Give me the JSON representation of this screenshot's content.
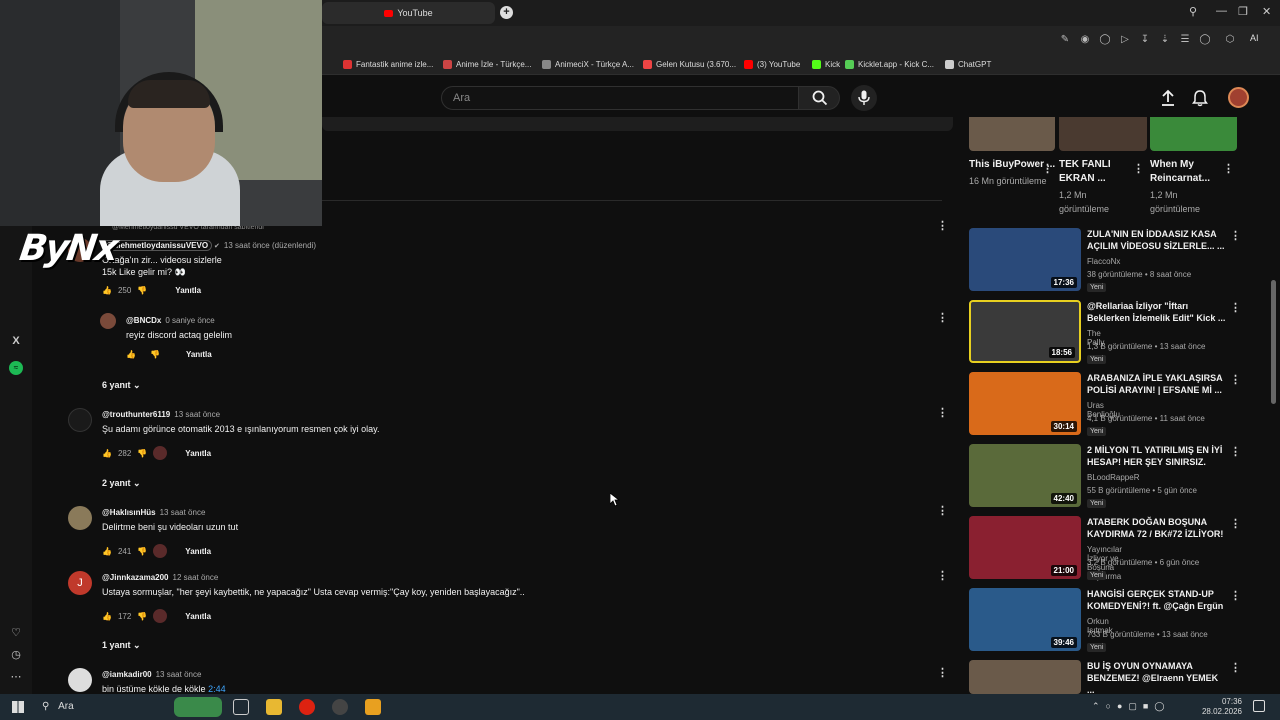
{
  "browser": {
    "tab_title": "YouTube",
    "bookmarks": [
      {
        "label": "Fantastik anime izle...",
        "color": "#d33"
      },
      {
        "label": "Anime İzle - Türkçe...",
        "color": "#c44"
      },
      {
        "label": "AnimeciX - Türkçe A...",
        "color": "#888"
      },
      {
        "label": "Gelen Kutusu (3.670...",
        "color": "#e44"
      },
      {
        "label": "(3) YouTube",
        "color": "#f00"
      },
      {
        "label": "Kick",
        "color": "#53fc18"
      },
      {
        "label": "Kicklet.app - Kick C...",
        "color": "#5c5"
      },
      {
        "label": "ChatGPT",
        "color": "#ccc"
      }
    ],
    "ai_label": "AI"
  },
  "header": {
    "search_placeholder": "Ara"
  },
  "overlay": {
    "brand": "ByNx"
  },
  "comments": {
    "pinned_note": "@Mehmetloydanissu VEVO tarafından sabitlendi",
    "items": [
      {
        "author": "@MehmetloydanissuVEVO",
        "time": "13 saat önce (düzenlendi)",
        "text": "Ortağa'ın zir... videosu sizlerle",
        "text2": "15k Like gelir mi? 👀",
        "likes": "250",
        "reply": "Yanıtla"
      },
      {
        "author": "@BNCDx",
        "time": "0 saniye önce",
        "text": "reyiz discord actaq gelelim",
        "likes": "",
        "reply": "Yanıtla"
      },
      {
        "toggle": "6 yanıt"
      },
      {
        "author": "@trouthunter6119",
        "time": "13 saat önce",
        "text": "Şu adamı görünce otomatik 2013 e ışınlanıyorum resmen çok iyi olay.",
        "likes": "282",
        "reply": "Yanıtla"
      },
      {
        "toggle": "2 yanıt"
      },
      {
        "author": "@HaklısınHüs",
        "time": "13 saat önce",
        "text": "Delirtme beni şu videoları uzun tut",
        "likes": "241",
        "reply": "Yanıtla"
      },
      {
        "author": "@Jinnkazama200",
        "time": "12 saat önce",
        "text": "Ustaya sormuşlar, \"her şeyi kaybettik, ne yapacağız\" Usta cevap vermiş:\"Çay koy, yeniden başlayacağız\"..",
        "likes": "172",
        "reply": "Yanıtla",
        "initial": "J"
      },
      {
        "toggle": "1 yanıt"
      },
      {
        "author": "@iamkadir00",
        "time": "13 saat önce",
        "text": "bin üstüme kökle de kökle",
        "timestamp_link": "2:44"
      }
    ]
  },
  "shorts": [
    {
      "title": "This iBuyPower ...",
      "views": "16 Mn görüntüleme"
    },
    {
      "title": "TEK FANLI EKRAN ...",
      "views": "1,2 Mn görüntüleme"
    },
    {
      "title": "When My Reincarnat...",
      "views": "1,2 Mn görüntüleme"
    }
  ],
  "related": [
    {
      "title": "ZULA'NIN EN İDDAASIZ KASA AÇILIM VİDEOSU SİZLERLE... ...",
      "channel": "FlaccoNx",
      "meta": "38 görüntüleme • 8 saat önce",
      "badge": "Yeni",
      "duration": "17:36",
      "color": "#2a4a7a"
    },
    {
      "title": "@Rellariaa İzliyor \"İftarı Beklerken İzlemelik Edit\" Kick ...",
      "channel": "The Pally",
      "meta": "1,3 B görüntüleme • 13 saat önce",
      "badge": "Yeni",
      "duration": "18:56",
      "color": "#3a3a3a"
    },
    {
      "title": "ARABANIZA İPLE YAKLAŞIRSA POLİSİ ARAYIN! | EFSANE Mİ ...",
      "channel": "Uras Benlioğlu",
      "meta": "4,1 B görüntüleme • 11 saat önce",
      "badge": "Yeni",
      "duration": "30:14",
      "color": "#d96a1a"
    },
    {
      "title": "2 MİLYON TL YATIRILMIŞ EN İYİ HESAP! HER ŞEY SINIRSIZ.",
      "channel": "BLoodRappeR",
      "meta": "55 B görüntüleme • 5 gün önce",
      "badge": "Yeni",
      "duration": "42:40",
      "color": "#5a6a3a"
    },
    {
      "title": "ATABERK DOĞAN BOŞUNA KAYDIRMA 72 / BK#72 İZLİYOR!",
      "channel": "Yayıncılar İzliyor ve Boşuna Kaydırma",
      "meta": "3,2 B görüntüleme • 6 gün önce",
      "badge": "Yeni",
      "duration": "21:00",
      "color": "#8a2030"
    },
    {
      "title": "HANGİSİ GERÇEK STAND-UP KOMEDYENİ?! ft. @Çağn Ergün",
      "channel": "Orkun Işıtmak",
      "meta": "733 B görüntüleme • 13 saat önce",
      "badge": "Yeni",
      "duration": "39:46",
      "color": "#2a5a8a"
    },
    {
      "title": "BU İŞ OYUN OYNAMAYA BENZEMEZ! @Elraenn YEMEK ...",
      "channel": "",
      "meta": "",
      "badge": "",
      "duration": "",
      "color": "#6a5a4a"
    }
  ],
  "taskbar": {
    "search_label": "Ara",
    "time": "07:36",
    "date": "28.02.2026"
  }
}
